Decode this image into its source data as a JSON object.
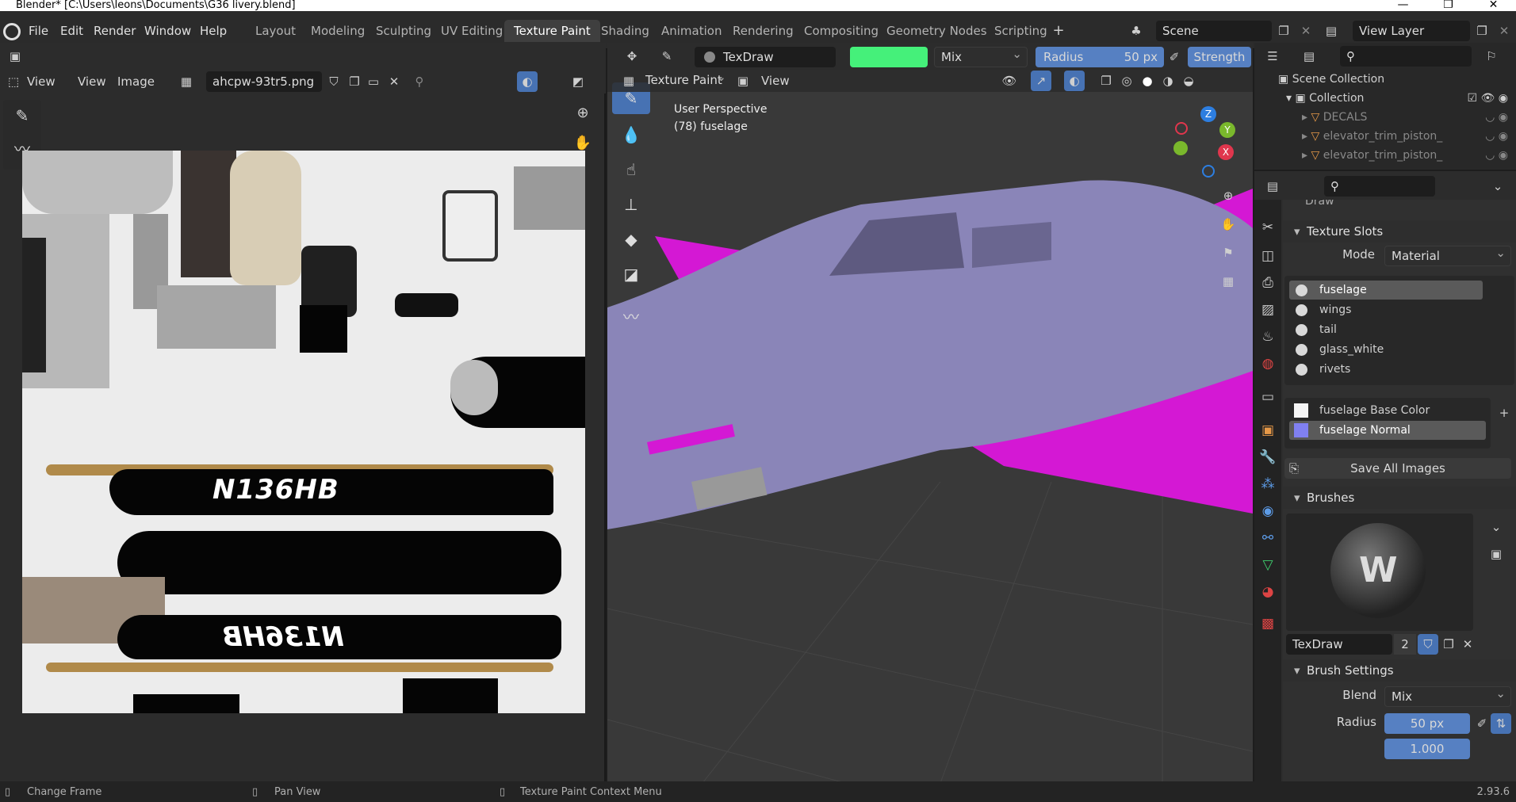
{
  "window": {
    "title": "Blender* [C:\\Users\\leons\\Documents\\G36 livery.blend]",
    "min": "—",
    "max": "❐",
    "close": "✕"
  },
  "menus": [
    "File",
    "Edit",
    "Render",
    "Window",
    "Help"
  ],
  "workspaces": [
    "Layout",
    "Modeling",
    "Sculpting",
    "UV Editing",
    "Texture Paint",
    "Shading",
    "Animation",
    "Rendering",
    "Compositing",
    "Geometry Nodes",
    "Scripting"
  ],
  "scene": {
    "name": "Scene",
    "view_layer": "View Layer"
  },
  "image_editor": {
    "view_menu1": "View",
    "view_menu2": "View",
    "image_menu": "Image",
    "image_name": "ahcpw-93tr5.png",
    "reg_top": "N136HB",
    "reg_bottom": "N136HB"
  },
  "tool_header": {
    "brush": "TexDraw",
    "color": "#45f07a",
    "blend": "Mix",
    "radius_label": "Radius",
    "radius_value": "50 px",
    "strength_label": "Strength"
  },
  "viewport": {
    "mode": "Texture Paint",
    "view_menu": "View",
    "perspective": "User Perspective",
    "object": "(78) fuselage",
    "wing_color": "#d418d4",
    "fuselage_color": "#8a85b8"
  },
  "outliner": {
    "scene_collection": "Scene Collection",
    "collection": "Collection",
    "items": [
      "DECALS",
      "elevator_trim_piston_",
      "elevator_trim_piston_"
    ]
  },
  "properties": {
    "brush_peek": "Draw",
    "texture_slots_title": "Texture Slots",
    "mode_label": "Mode",
    "mode_value": "Material",
    "materials": [
      "fuselage",
      "wings",
      "tail",
      "glass_white",
      "rivets"
    ],
    "images": [
      "fuselage Base Color",
      "fuselage Normal"
    ],
    "save_all": "Save All Images",
    "brushes_title": "Brushes",
    "brush_name": "TexDraw",
    "brush_users": "2",
    "brush_settings_title": "Brush Settings",
    "blend_label": "Blend",
    "blend_value": "Mix",
    "radius_label": "Radius",
    "radius_value": "50 px",
    "strength_peek": "1.000"
  },
  "status": {
    "left": "Change Frame",
    "mid": "Pan View",
    "right": "Texture Paint Context Menu",
    "version": "2.93.6"
  }
}
